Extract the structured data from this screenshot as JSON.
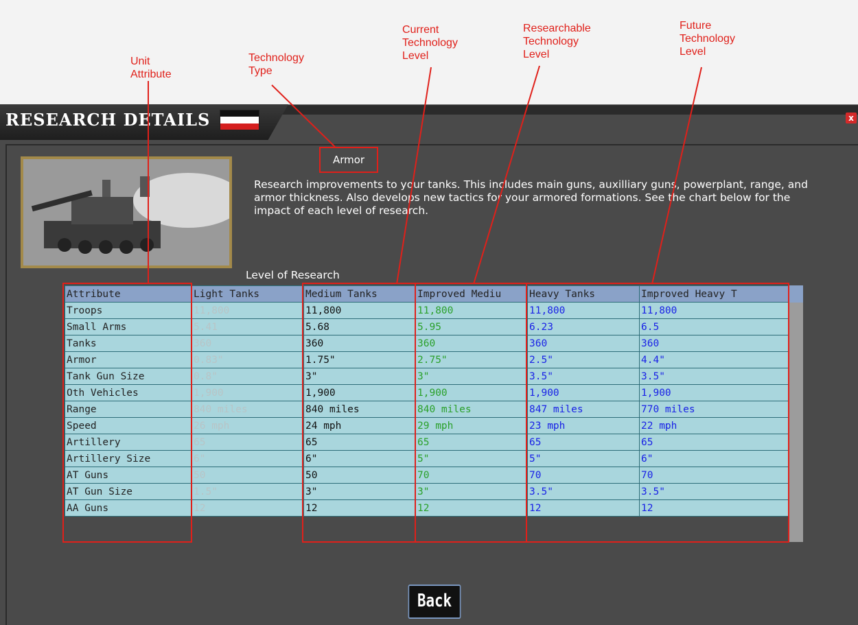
{
  "annotations": {
    "unit_attribute": [
      "Unit",
      "Attribute"
    ],
    "technology_type": [
      "Technology",
      "Type"
    ],
    "current_level": [
      "Current",
      "Technology",
      "Level"
    ],
    "researchable_level": [
      "Researchable",
      "Technology",
      "Level"
    ],
    "future_level": [
      "Future",
      "Technology",
      "Level"
    ]
  },
  "window": {
    "title": "RESEARCH DETAILS",
    "flag_colors": [
      "#111111",
      "#ffffff",
      "#d51f1f"
    ],
    "close_label": "x"
  },
  "tech_type": "Armor",
  "description": "Research improvements to your tanks.  This includes main guns, auxilliary guns, powerplant, range, and armor thickness. Also develops new tactics for your armored formations.  See the chart below for the impact of each level of research.",
  "level_label": "Level of Research",
  "table": {
    "headers": [
      "Attribute",
      "Light Tanks",
      "Medium Tanks",
      "Improved Mediu",
      "Heavy Tanks",
      "Improved Heavy T"
    ],
    "rows": [
      [
        "Troops",
        "11,800",
        "11,800",
        "11,800",
        "11,800",
        "11,800"
      ],
      [
        "Small Arms",
        "5.41",
        "5.68",
        "5.95",
        "6.23",
        "6.5"
      ],
      [
        "Tanks",
        "360",
        "360",
        "360",
        "360",
        "360"
      ],
      [
        "Armor",
        "0.83\"",
        "1.75\"",
        "2.75\"",
        "2.5\"",
        "4.4\""
      ],
      [
        "Tank Gun Size",
        "0.8\"",
        "3\"",
        "3\"",
        "3.5\"",
        "3.5\""
      ],
      [
        "Oth Vehicles",
        "1,900",
        "1,900",
        "1,900",
        "1,900",
        "1,900"
      ],
      [
        "Range",
        "840 miles",
        "840 miles",
        "840 miles",
        "847 miles",
        "770 miles"
      ],
      [
        "Speed",
        "26 mph",
        "24 mph",
        "29 mph",
        "23 mph",
        "22 mph"
      ],
      [
        "Artillery",
        "65",
        "65",
        "65",
        "65",
        "65"
      ],
      [
        "Artillery Size",
        "6\"",
        "6\"",
        "5\"",
        "5\"",
        "6\""
      ],
      [
        "AT Guns",
        "50",
        "50",
        "70",
        "70",
        "70"
      ],
      [
        "AT Gun Size",
        "1.5\"",
        "3\"",
        "3\"",
        "3.5\"",
        "3.5\""
      ],
      [
        "AA Guns",
        "12",
        "12",
        "12",
        "12",
        "12"
      ]
    ]
  },
  "back_label": "Back",
  "colors": {
    "annotation_red": "#e0201a",
    "light_col": "#b8c4c6",
    "medium_col": "#111111",
    "improved_medium_col": "#2aa02a",
    "heavy_col": "#1a22e6",
    "cell_bg": "#a9d6dd",
    "header_bg": "#8aa2c8"
  }
}
